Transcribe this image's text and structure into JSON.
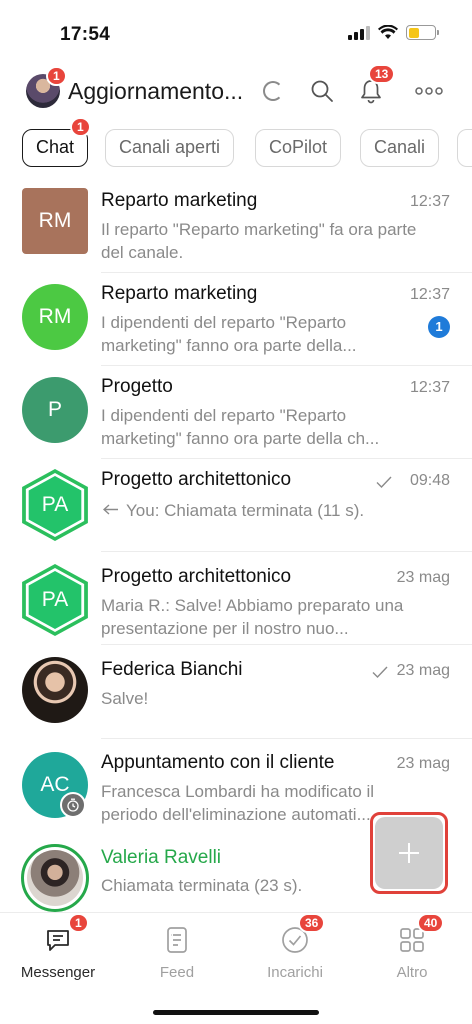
{
  "status_bar": {
    "time": "17:54"
  },
  "header": {
    "title": "Aggiornamento...",
    "avatar_badge": "1",
    "notifications_badge": "13"
  },
  "tabs": [
    {
      "label": "Chat",
      "badge": "1",
      "active": true
    },
    {
      "label": "Canali aperti"
    },
    {
      "label": "CoPilot"
    },
    {
      "label": "Canali"
    }
  ],
  "chats": [
    {
      "avatar_text": "RM",
      "avatar_color": "#a8735c",
      "title": "Reparto marketing",
      "time": "12:37",
      "preview": "Il reparto \"Reparto marketing\" fa ora parte del canale."
    },
    {
      "avatar_text": "RM",
      "avatar_color": "#4cc943",
      "title": "Reparto marketing",
      "time": "12:37",
      "preview": "I dipendenti del reparto \"Reparto marketing\" fanno ora parte della...",
      "unread": "1"
    },
    {
      "avatar_text": "P",
      "avatar_color": "#3c9b6e",
      "title": "Progetto",
      "time": "12:37",
      "preview": "I dipendenti del reparto \"Reparto marketing\" fanno ora parte della ch..."
    },
    {
      "avatar_text": "PA",
      "avatar_color": "#23c36a",
      "title": "Progetto architettonico",
      "time": "09:48",
      "preview": "You: Chiamata terminata (11 s)."
    },
    {
      "avatar_text": "PA",
      "avatar_color": "#23c36a",
      "title": "Progetto architettonico",
      "time": "23 mag",
      "preview": "Maria R.: Salve! Abbiamo preparato una presentazione per il nostro nuo..."
    },
    {
      "title": "Federica Bianchi",
      "time": "23 mag",
      "preview": "Salve!"
    },
    {
      "avatar_text": "AC",
      "avatar_color": "#1fa89a",
      "title": "Appuntamento con il cliente",
      "time": "23 mag",
      "preview": "Francesca Lombardi ha modificato il periodo dell'eliminazione automati..."
    },
    {
      "title": "Valeria Ravelli",
      "title_color": "#25a84a",
      "preview": "Chiamata terminata (23 s)."
    }
  ],
  "bottom_nav": [
    {
      "label": "Messenger",
      "badge": "1",
      "active": true
    },
    {
      "label": "Feed"
    },
    {
      "label": "Incarichi",
      "badge": "36"
    },
    {
      "label": "Altro",
      "badge": "40"
    }
  ]
}
